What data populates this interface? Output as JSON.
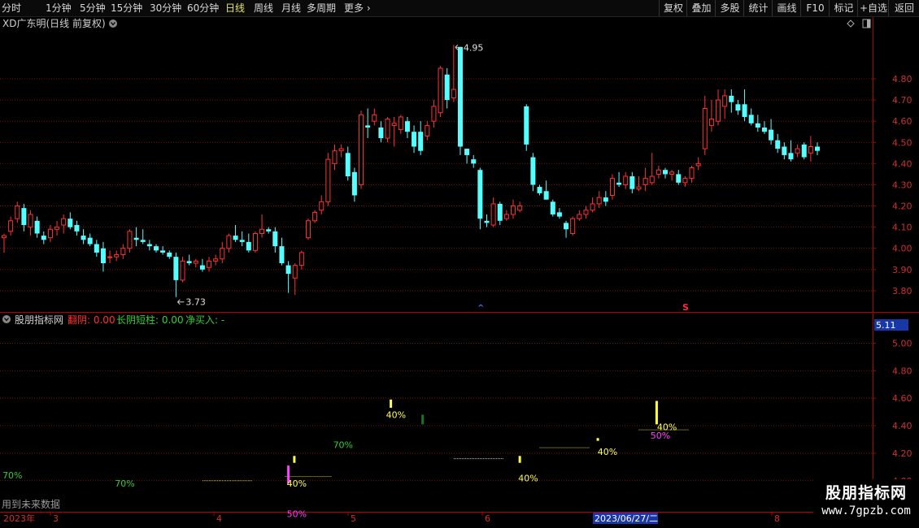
{
  "toolbar": {
    "periods": [
      "分时",
      "1分钟",
      "5分钟",
      "15分钟",
      "30分钟",
      "60分钟",
      "日线",
      "周线",
      "月线",
      "多周期",
      "更多"
    ],
    "active_period": "日线",
    "right_buttons": [
      "复权",
      "叠加",
      "多股",
      "统计",
      "画线",
      "F10",
      "标记",
      "+自选",
      "返回"
    ]
  },
  "main_panel": {
    "title": "XD广东明(日线 前复权)",
    "high_label": "4.95",
    "low_label": "3.73",
    "marker_up": "^",
    "marker_s": "S"
  },
  "indicator_panel": {
    "title": "股朋指标网",
    "items": [
      {
        "label": "翻阴: 0.00",
        "color": "#ff3030"
      },
      {
        "label": "长阴短柱: 0.00",
        "color": "#30d030"
      },
      {
        "label": "净买入: -",
        "color": "#30d030"
      }
    ],
    "current_value": "5.11",
    "note": "用到未来数据"
  },
  "watermark": {
    "title": "股朋指标网",
    "url": "www.7gpzb.com"
  },
  "colors": {
    "up": "#ff3232",
    "down": "#54ffff",
    "grid": "#7a1010",
    "axis": "#b00000"
  },
  "chart_data": {
    "type": "candlestick",
    "price_ticks": [
      3.8,
      3.9,
      4.0,
      4.1,
      4.2,
      4.3,
      4.4,
      4.5,
      4.6,
      4.7,
      4.8
    ],
    "price_range": [
      3.7,
      5.03
    ],
    "indicator_ticks": [
      4.0,
      4.2,
      4.4,
      4.6,
      4.8,
      5.0
    ],
    "indicator_range": [
      3.78,
      5.18
    ],
    "x_axis": {
      "year_label": "2023年",
      "months": [
        "3",
        "4",
        "5",
        "6",
        "7",
        "8"
      ],
      "cursor_label": "2023/06/27/二"
    },
    "candles": [
      [
        4.05,
        4.07,
        3.98,
        4.06
      ],
      [
        4.08,
        4.15,
        4.06,
        4.13
      ],
      [
        4.14,
        4.22,
        4.12,
        4.2
      ],
      [
        4.19,
        4.21,
        4.08,
        4.11
      ],
      [
        4.1,
        4.18,
        4.06,
        4.16
      ],
      [
        4.13,
        4.15,
        4.05,
        4.07
      ],
      [
        4.06,
        4.08,
        4.02,
        4.04
      ],
      [
        4.05,
        4.11,
        4.03,
        4.09
      ],
      [
        4.09,
        4.13,
        4.06,
        4.1
      ],
      [
        4.11,
        4.16,
        4.07,
        4.14
      ],
      [
        4.14,
        4.17,
        4.09,
        4.1
      ],
      [
        4.11,
        4.13,
        4.06,
        4.08
      ],
      [
        4.06,
        4.09,
        4.02,
        4.04
      ],
      [
        4.05,
        4.07,
        4.01,
        4.02
      ],
      [
        4.02,
        4.04,
        3.96,
        3.98
      ],
      [
        4.0,
        4.03,
        3.89,
        3.93
      ],
      [
        3.96,
        3.99,
        3.93,
        3.96
      ],
      [
        3.96,
        3.99,
        3.94,
        3.97
      ],
      [
        3.97,
        4.02,
        3.95,
        4.0
      ],
      [
        4.0,
        4.09,
        3.98,
        4.08
      ],
      [
        4.05,
        4.1,
        4.01,
        4.04
      ],
      [
        4.04,
        4.09,
        4.02,
        4.03
      ],
      [
        4.02,
        4.04,
        3.99,
        4.01
      ],
      [
        4.01,
        4.02,
        3.98,
        3.99
      ],
      [
        3.99,
        4.01,
        3.97,
        3.98
      ],
      [
        3.98,
        3.99,
        3.95,
        3.96
      ],
      [
        3.96,
        3.98,
        3.77,
        3.85
      ],
      [
        3.85,
        3.96,
        3.84,
        3.94
      ],
      [
        3.94,
        3.97,
        3.92,
        3.93
      ],
      [
        3.93,
        3.95,
        3.91,
        3.94
      ],
      [
        3.92,
        3.95,
        3.89,
        3.9
      ],
      [
        3.91,
        3.96,
        3.89,
        3.94
      ],
      [
        3.94,
        3.97,
        3.92,
        3.95
      ],
      [
        3.95,
        4.03,
        3.93,
        4.0
      ],
      [
        4.0,
        4.07,
        3.98,
        4.06
      ],
      [
        4.06,
        4.11,
        4.03,
        4.04
      ],
      [
        4.04,
        4.08,
        4.01,
        4.03
      ],
      [
        4.03,
        4.07,
        3.98,
        3.99
      ],
      [
        3.99,
        4.08,
        3.98,
        4.07
      ],
      [
        4.07,
        4.16,
        4.05,
        4.09
      ],
      [
        4.09,
        4.1,
        4.07,
        4.08
      ],
      [
        4.08,
        4.1,
        3.98,
        4.01
      ],
      [
        4.01,
        4.05,
        3.92,
        3.93
      ],
      [
        3.92,
        3.94,
        3.79,
        3.88
      ],
      [
        3.86,
        3.93,
        3.78,
        3.92
      ],
      [
        3.92,
        3.99,
        3.9,
        3.98
      ],
      [
        4.05,
        4.14,
        4.04,
        4.13
      ],
      [
        4.13,
        4.18,
        4.12,
        4.17
      ],
      [
        4.18,
        4.25,
        4.16,
        4.22
      ],
      [
        4.22,
        4.45,
        4.2,
        4.42
      ],
      [
        4.4,
        4.49,
        4.37,
        4.46
      ],
      [
        4.46,
        4.49,
        4.43,
        4.47
      ],
      [
        4.45,
        4.48,
        4.32,
        4.34
      ],
      [
        4.36,
        4.38,
        4.22,
        4.25
      ],
      [
        4.3,
        4.65,
        4.28,
        4.63
      ],
      [
        4.58,
        4.66,
        4.52,
        4.57
      ],
      [
        4.6,
        4.66,
        4.58,
        4.63
      ],
      [
        4.57,
        4.6,
        4.5,
        4.52
      ],
      [
        4.52,
        4.62,
        4.5,
        4.61
      ],
      [
        4.58,
        4.62,
        4.48,
        4.59
      ],
      [
        4.56,
        4.63,
        4.54,
        4.62
      ],
      [
        4.6,
        4.62,
        4.52,
        4.55
      ],
      [
        4.55,
        4.58,
        4.45,
        4.48
      ],
      [
        4.55,
        4.6,
        4.44,
        4.46
      ],
      [
        4.53,
        4.6,
        4.51,
        4.58
      ],
      [
        4.6,
        4.7,
        4.57,
        4.67
      ],
      [
        4.64,
        4.86,
        4.62,
        4.85
      ],
      [
        4.82,
        4.85,
        4.66,
        4.7
      ],
      [
        4.71,
        4.96,
        4.69,
        4.75
      ],
      [
        4.95,
        4.95,
        4.44,
        4.48
      ],
      [
        4.47,
        4.47,
        4.4,
        4.44
      ],
      [
        4.42,
        4.44,
        4.38,
        4.4
      ],
      [
        4.37,
        4.38,
        4.09,
        4.14
      ],
      [
        4.13,
        4.16,
        4.1,
        4.12
      ],
      [
        4.11,
        4.24,
        4.1,
        4.21
      ],
      [
        4.21,
        4.22,
        4.11,
        4.13
      ],
      [
        4.14,
        4.18,
        4.13,
        4.16
      ],
      [
        4.16,
        4.23,
        4.14,
        4.2
      ],
      [
        4.18,
        4.22,
        4.17,
        4.2
      ],
      [
        4.67,
        4.68,
        4.46,
        4.49
      ],
      [
        4.43,
        4.45,
        4.27,
        4.3
      ],
      [
        4.29,
        4.3,
        4.25,
        4.26
      ],
      [
        4.27,
        4.32,
        4.23,
        4.23
      ],
      [
        4.22,
        4.23,
        4.15,
        4.16
      ],
      [
        4.17,
        4.19,
        4.14,
        4.15
      ],
      [
        4.12,
        4.13,
        4.05,
        4.09
      ],
      [
        4.07,
        4.15,
        4.06,
        4.14
      ],
      [
        4.14,
        4.18,
        4.13,
        4.16
      ],
      [
        4.16,
        4.2,
        4.14,
        4.18
      ],
      [
        4.18,
        4.24,
        4.17,
        4.21
      ],
      [
        4.21,
        4.27,
        4.19,
        4.24
      ],
      [
        4.24,
        4.27,
        4.2,
        4.22
      ],
      [
        4.25,
        4.35,
        4.23,
        4.33
      ],
      [
        4.31,
        4.36,
        4.29,
        4.3
      ],
      [
        4.3,
        4.36,
        4.28,
        4.34
      ],
      [
        4.34,
        4.36,
        4.26,
        4.28
      ],
      [
        4.28,
        4.34,
        4.27,
        4.29
      ],
      [
        4.3,
        4.38,
        4.27,
        4.33
      ],
      [
        4.31,
        4.45,
        4.3,
        4.34
      ],
      [
        4.35,
        4.39,
        4.33,
        4.37
      ],
      [
        4.37,
        4.38,
        4.33,
        4.35
      ],
      [
        4.35,
        4.37,
        4.32,
        4.36
      ],
      [
        4.35,
        4.37,
        4.3,
        4.31
      ],
      [
        4.31,
        4.34,
        4.29,
        4.33
      ],
      [
        4.33,
        4.39,
        4.31,
        4.38
      ],
      [
        4.39,
        4.43,
        4.37,
        4.4
      ],
      [
        4.47,
        4.72,
        4.44,
        4.66
      ],
      [
        4.58,
        4.7,
        4.55,
        4.61
      ],
      [
        4.6,
        4.75,
        4.58,
        4.7
      ],
      [
        4.67,
        4.75,
        4.61,
        4.72
      ],
      [
        4.72,
        4.75,
        4.64,
        4.69
      ],
      [
        4.68,
        4.7,
        4.63,
        4.65
      ],
      [
        4.68,
        4.75,
        4.6,
        4.62
      ],
      [
        4.63,
        4.66,
        4.58,
        4.59
      ],
      [
        4.59,
        4.63,
        4.55,
        4.57
      ],
      [
        4.57,
        4.6,
        4.54,
        4.55
      ],
      [
        4.56,
        4.61,
        4.49,
        4.51
      ],
      [
        4.51,
        4.54,
        4.45,
        4.47
      ],
      [
        4.48,
        4.5,
        4.42,
        4.44
      ],
      [
        4.45,
        4.51,
        4.41,
        4.42
      ],
      [
        4.45,
        4.49,
        4.43,
        4.47
      ],
      [
        4.49,
        4.5,
        4.42,
        4.43
      ],
      [
        4.45,
        4.53,
        4.41,
        4.48
      ],
      [
        4.48,
        4.5,
        4.44,
        4.46
      ]
    ],
    "indicator_labels": [
      {
        "text": "70%",
        "i": 0.5,
        "y": 4.04,
        "color": "#30d030"
      },
      {
        "text": "70%",
        "i": 17.5,
        "y": 3.98,
        "color": "#30d030"
      },
      {
        "text": "40%",
        "i": 43.5,
        "y": 3.98,
        "color": "#ffff40"
      },
      {
        "text": "50%",
        "i": 43.5,
        "y": 3.76,
        "color": "#ff40ff"
      },
      {
        "text": "70%",
        "i": 50.5,
        "y": 4.26,
        "color": "#30d030"
      },
      {
        "text": "40%",
        "i": 58.5,
        "y": 4.48,
        "color": "#ffff40"
      },
      {
        "text": "40%",
        "i": 78.5,
        "y": 4.02,
        "color": "#ffff40"
      },
      {
        "text": "40%",
        "i": 90.5,
        "y": 4.21,
        "color": "#ffff40"
      },
      {
        "text": "50%",
        "i": 98.5,
        "y": 4.33,
        "color": "#ff40ff"
      },
      {
        "text": "40%",
        "i": 99.5,
        "y": 4.39,
        "color": "#ffff40"
      }
    ],
    "indicator_bars": [
      {
        "i": 43,
        "from": 3.98,
        "to": 4.11,
        "color": "#ff40ff"
      },
      {
        "i": 43.9,
        "from": 4.13,
        "to": 4.18,
        "color": "#ffff40"
      },
      {
        "i": 58.5,
        "from": 4.53,
        "to": 4.59,
        "color": "#ffff40"
      },
      {
        "i": 63.3,
        "from": 4.41,
        "to": 4.48,
        "color": "#207020"
      },
      {
        "i": 78,
        "from": 4.13,
        "to": 4.18,
        "color": "#ffff40"
      },
      {
        "i": 89.8,
        "from": 4.29,
        "to": 4.31,
        "color": "#ffff40"
      },
      {
        "i": 98.7,
        "from": 4.41,
        "to": 4.58,
        "color": "#ffff40"
      }
    ],
    "indicator_dashes": [
      {
        "i0": 30,
        "i1": 37.5,
        "y": 4.0,
        "color": "#d0d040"
      },
      {
        "i0": 42.5,
        "i1": 49.5,
        "y": 4.03,
        "color": "#d0d040"
      },
      {
        "i0": 68,
        "i1": 75.5,
        "y": 4.16,
        "color": "#d0d0d0"
      },
      {
        "i0": 81,
        "i1": 88.5,
        "y": 4.24,
        "color": "#d0d040"
      },
      {
        "i0": 96,
        "i1": 103.5,
        "y": 4.37,
        "color": "#d0d040"
      }
    ]
  }
}
